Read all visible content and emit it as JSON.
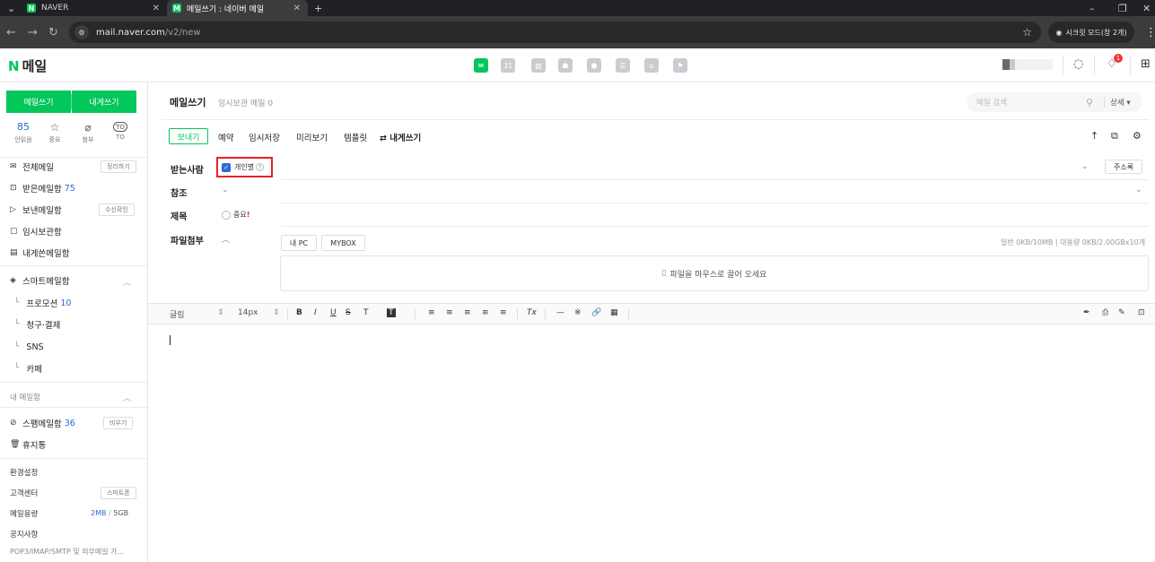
{
  "browser": {
    "tabs": [
      {
        "title": "NAVER",
        "favicon": "N"
      },
      {
        "title": "메일쓰기 : 네이버 메일",
        "favicon": "M"
      }
    ],
    "new_tab": "+",
    "url_host": "mail.naver.com",
    "url_path": "/v2/new",
    "incognito_label": "시크릿 모드(창 2개)",
    "window_min": "–",
    "window_restore": "❐",
    "window_close": "✕"
  },
  "header": {
    "logo_n": "N",
    "logo_text": "메일",
    "services": [
      "mail-icon",
      "calendar-icon",
      "photo-icon",
      "contacts-icon",
      "mybox-icon",
      "memo-icon",
      "home-icon",
      "bookmark-icon"
    ],
    "notification_count": "1"
  },
  "sidebar": {
    "compose_label": "메일쓰기",
    "selfmail_label": "내게쓰기",
    "quick": [
      {
        "value": "85",
        "label": "안읽음"
      },
      {
        "icon": "☆",
        "label": "중요"
      },
      {
        "icon": "⌀",
        "label": "첨부"
      },
      {
        "icon": "TO",
        "label": "TO"
      }
    ],
    "all_mail": "전체메일",
    "organize": "정리하기",
    "inbox": "받은메일함",
    "inbox_count": "75",
    "sent": "보낸메일함",
    "receipt": "수신확인",
    "drafts": "임시보관함",
    "self_box": "내게쓴메일함",
    "smart_box": "스마트메일함",
    "smart_items": [
      {
        "label": "프로모션",
        "count": "10"
      },
      {
        "label": "청구·결제",
        "count": ""
      },
      {
        "label": "SNS",
        "count": ""
      },
      {
        "label": "카페",
        "count": ""
      }
    ],
    "my_box": "내 메일함",
    "spam": "스팸메일함",
    "spam_count": "36",
    "empty": "비우기",
    "trash": "휴지통",
    "settings": "환경설정",
    "support": "고객센터",
    "smartphone": "스마트폰",
    "storage": "메일용량",
    "storage_used": "2MB",
    "storage_sep": "/",
    "storage_total": "5GB",
    "notice": "공지사항",
    "pop3": "POP3/IMAP/SMTP 및 외부메일 가..."
  },
  "compose": {
    "title": "메일쓰기",
    "drafts_info": "임시보관 메일 0",
    "search_placeholder": "메일 검색",
    "search_detail": "상세 ▾",
    "send": "보내기",
    "toolbar": [
      "예약",
      "임시저장",
      "미리보기",
      "템플릿",
      "⇄ 내게쓰기"
    ],
    "to_label": "받는사람",
    "individual": "개인별",
    "help": "?",
    "addressbook": "주소록",
    "cc_label": "참조",
    "subject_label": "제목",
    "important": "중요",
    "important_mark": "!",
    "attach_label": "파일첨부",
    "my_pc": "내 PC",
    "mybox": "MYBOX",
    "attach_capacity": "일반 0KB/10MB | 대용량 0KB/2.00GBx10개",
    "drop_hint": "파일을 마우스로 끌어 오세요"
  },
  "editor": {
    "font": "글림",
    "size": "14px",
    "tools": [
      "B",
      "I",
      "U",
      "S",
      "T",
      "T",
      "≡",
      "≡",
      "≡",
      "≡",
      "≡",
      "Tx",
      "—",
      "※",
      "🔗",
      "▦"
    ]
  },
  "colors": {
    "brand": "#03c75a",
    "link": "#2b6bd6",
    "highlight": "#e8202a"
  }
}
